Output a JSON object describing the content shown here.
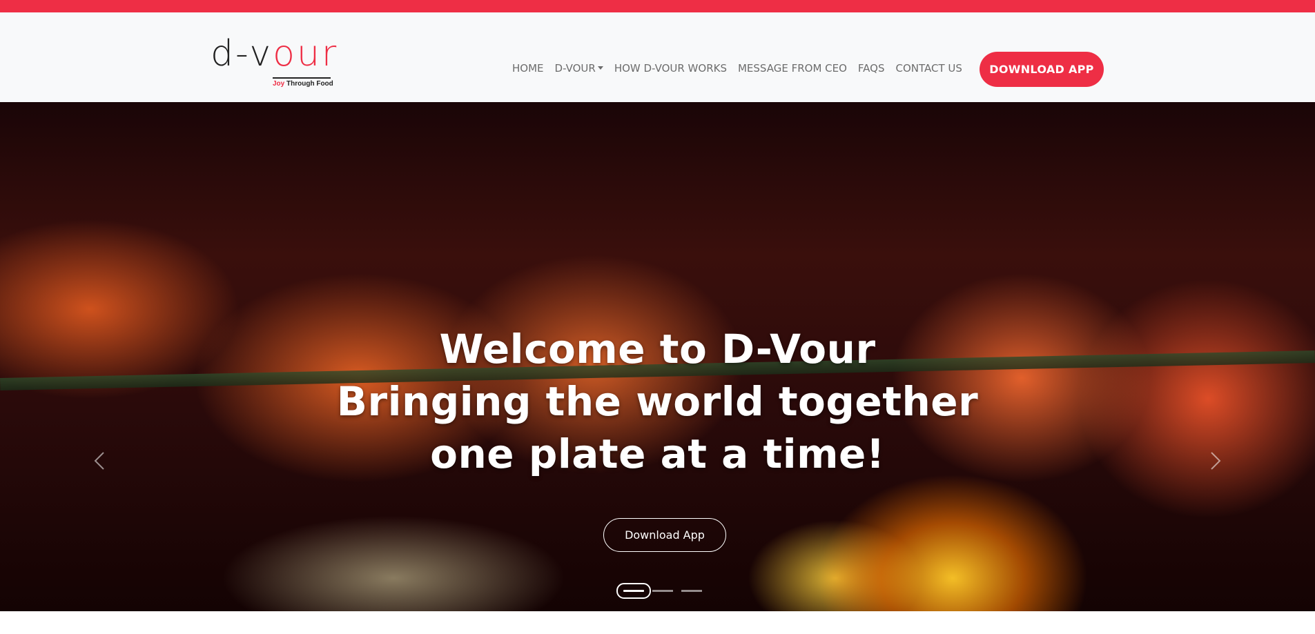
{
  "colors": {
    "brand_red": "#ee2e45",
    "nav_text": "#6c6c6c",
    "navbar_bg": "#f8f9fa"
  },
  "logo": {
    "part1": "d-v",
    "part2": "our",
    "tagline_red": "Joy",
    "tagline_rest": " Through Food"
  },
  "nav": {
    "items": [
      {
        "label": "HOME"
      },
      {
        "label": "D-VOUR",
        "has_dropdown": true
      },
      {
        "label": "HOW D-VOUR WORKS"
      },
      {
        "label": "MESSAGE FROM CEO"
      },
      {
        "label": "FAQS"
      },
      {
        "label": "CONTACT US"
      }
    ],
    "cta_label": "DOWNLOAD APP"
  },
  "hero": {
    "line1": "Welcome to D-Vour",
    "line2": "Bringing the world together",
    "line3": "one plate at a time!",
    "cta_label": "Download App",
    "prev_icon": "chevron-left-icon",
    "next_icon": "chevron-right-icon",
    "slide_count": 3,
    "active_slide": 1
  }
}
